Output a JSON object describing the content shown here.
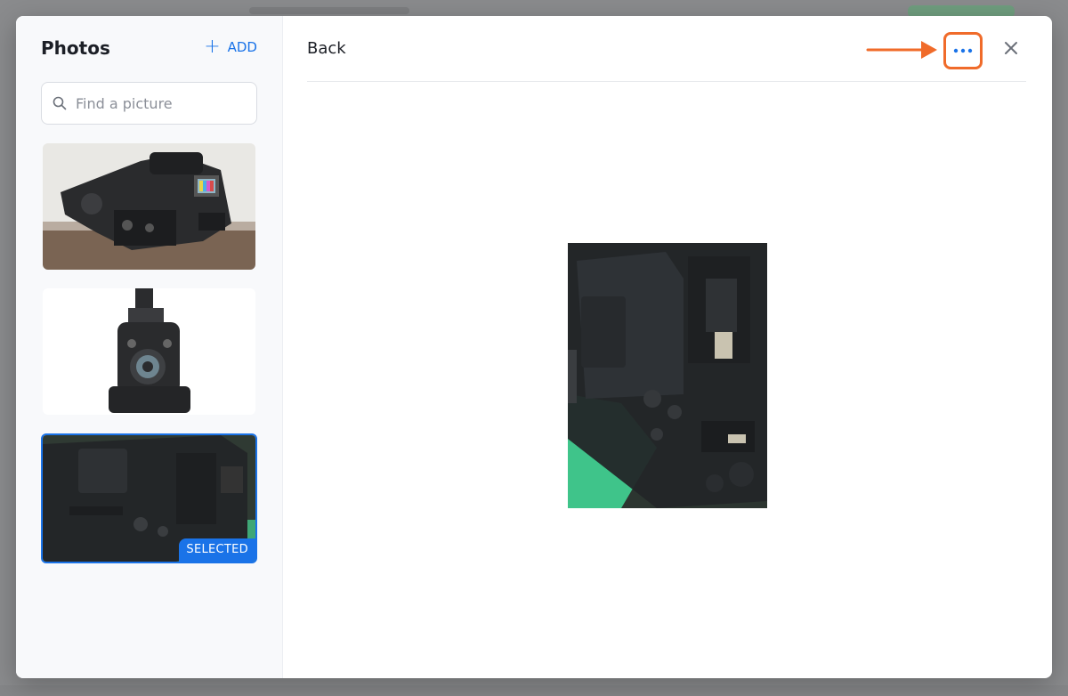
{
  "sidebar": {
    "title": "Photos",
    "add_label": "ADD",
    "search_placeholder": "Find a picture",
    "thumbnails": [
      {
        "icon": "camera-photo-icon"
      },
      {
        "icon": "camera-photo-icon"
      },
      {
        "icon": "camera-photo-icon",
        "badge": "SELECTED"
      }
    ]
  },
  "main": {
    "back_label": "Back"
  },
  "colors": {
    "accent": "#1a73e8",
    "highlight": "#f06b2a"
  }
}
